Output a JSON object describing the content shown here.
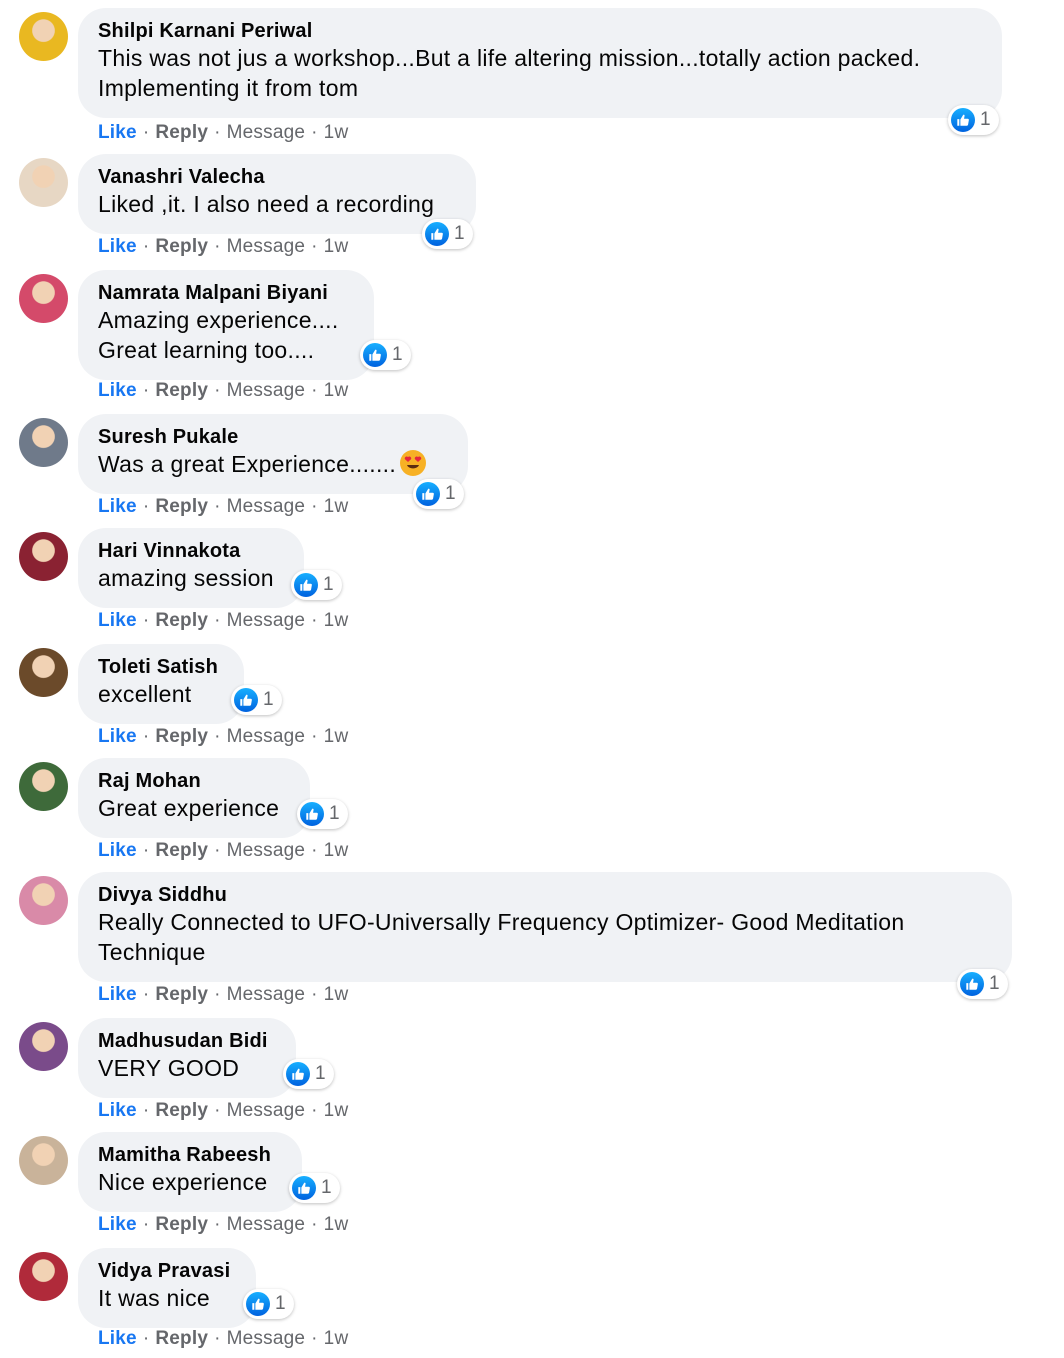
{
  "actions": {
    "like": "Like",
    "reply": "Reply",
    "message": "Message",
    "sep": "·"
  },
  "colors": {
    "like_blue": "#1877f2",
    "bubble_bg": "#f0f2f5",
    "meta_gray": "#65676b"
  },
  "reaction_icon": "like-thumbs-up-icon",
  "comments": [
    {
      "author": "Shilpi Karnani Periwal",
      "lines": [
        "This was not jus a workshop...But a life altering mission...totally action packed.",
        "Implementing it from tom"
      ],
      "reactions": "1",
      "time": "1w",
      "avatar_color": "#e9b821"
    },
    {
      "author": "Vanashri Valecha",
      "lines": [
        "Liked ,it. I also need a recording"
      ],
      "reactions": "1",
      "time": "1w",
      "avatar_color": "#e7d7c4"
    },
    {
      "author": "Namrata Malpani Biyani",
      "lines": [
        "Amazing experience....",
        "Great learning too...."
      ],
      "reactions": "1",
      "time": "1w",
      "avatar_color": "#d44a6a"
    },
    {
      "author": "Suresh Pukale",
      "lines": [
        "Was a great Experience......."
      ],
      "emoji": "heart-eyes-emoji",
      "reactions": "1",
      "time": "1w",
      "avatar_color": "#6f7a8a"
    },
    {
      "author": "Hari Vinnakota",
      "lines": [
        "amazing session"
      ],
      "reactions": "1",
      "time": "1w",
      "avatar_color": "#8a2232"
    },
    {
      "author": "Toleti Satish",
      "lines": [
        "excellent"
      ],
      "reactions": "1",
      "time": "1w",
      "avatar_color": "#6b4a2a"
    },
    {
      "author": "Raj Mohan",
      "lines": [
        "Great experience"
      ],
      "reactions": "1",
      "time": "1w",
      "avatar_color": "#3e6a3a"
    },
    {
      "author": "Divya Siddhu",
      "lines": [
        "Really Connected to UFO-Universally Frequency Optimizer- Good Meditation",
        "Technique"
      ],
      "reactions": "1",
      "time": "1w",
      "avatar_color": "#d98aa8"
    },
    {
      "author": "Madhusudan Bidi",
      "lines": [
        "VERY GOOD"
      ],
      "reactions": "1",
      "time": "1w",
      "avatar_color": "#7a4b8a"
    },
    {
      "author": "Mamitha Rabeesh",
      "lines": [
        "Nice experience"
      ],
      "reactions": "1",
      "time": "1w",
      "avatar_color": "#c9b39a"
    },
    {
      "author": "Vidya Pravasi",
      "lines": [
        "It was nice"
      ],
      "reactions": "1",
      "time": "1w",
      "avatar_color": "#b02a3a"
    }
  ]
}
